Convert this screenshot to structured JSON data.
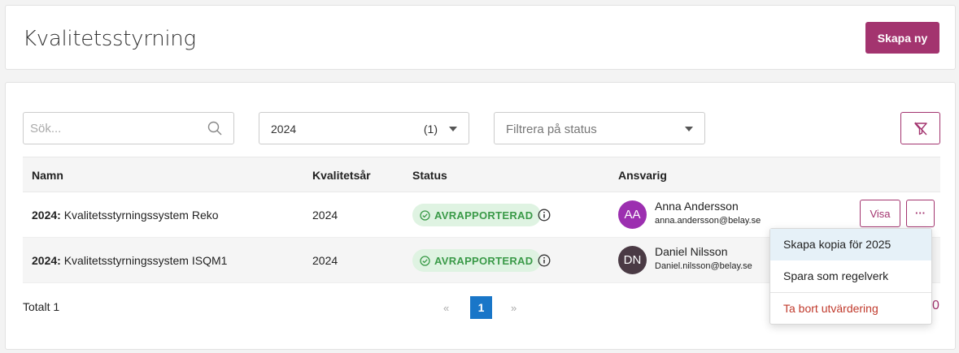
{
  "header": {
    "title": "Kvalitetsstyrning",
    "create_button": "Skapa ny"
  },
  "filters": {
    "search_placeholder": "Sök...",
    "year_value": "2024",
    "year_count": "(1)",
    "status_placeholder": "Filtrera på status",
    "clear_filter_icon": "filter-off-icon"
  },
  "table": {
    "columns": [
      "Namn",
      "Kvalitetsår",
      "Status",
      "Ansvarig"
    ],
    "rows": [
      {
        "name_prefix": "2024:",
        "name": " Kvalitetsstyrningssystem Reko",
        "year": "2024",
        "status": "AVRAPPORTERAD",
        "person_initials": "AA",
        "person_name": "Anna Andersson",
        "person_email": "anna.andersson@belay.se",
        "action_label": "Visa",
        "more_label": "···"
      },
      {
        "name_prefix": "2024:",
        "name": " Kvalitetsstyrningssystem ISQM1",
        "year": "2024",
        "status": "AVRAPPORTERAD",
        "person_initials": "DN",
        "person_name": "Daniel Nilsson",
        "person_email": "Daniel.nilsson@belay.se"
      }
    ]
  },
  "footer": {
    "total": "Totalt 1",
    "prev": "«",
    "page": "1",
    "next": "»",
    "trailing": "0"
  },
  "dropdown": {
    "items": [
      "Skapa kopia för 2025",
      "Spara som regelverk",
      "Ta bort utvärdering"
    ]
  },
  "colors": {
    "brand": "#a3346f",
    "status_bg": "#dff3e2",
    "status_text": "#3a9a48",
    "page_active": "#1976c8",
    "danger": "#c0392b"
  }
}
